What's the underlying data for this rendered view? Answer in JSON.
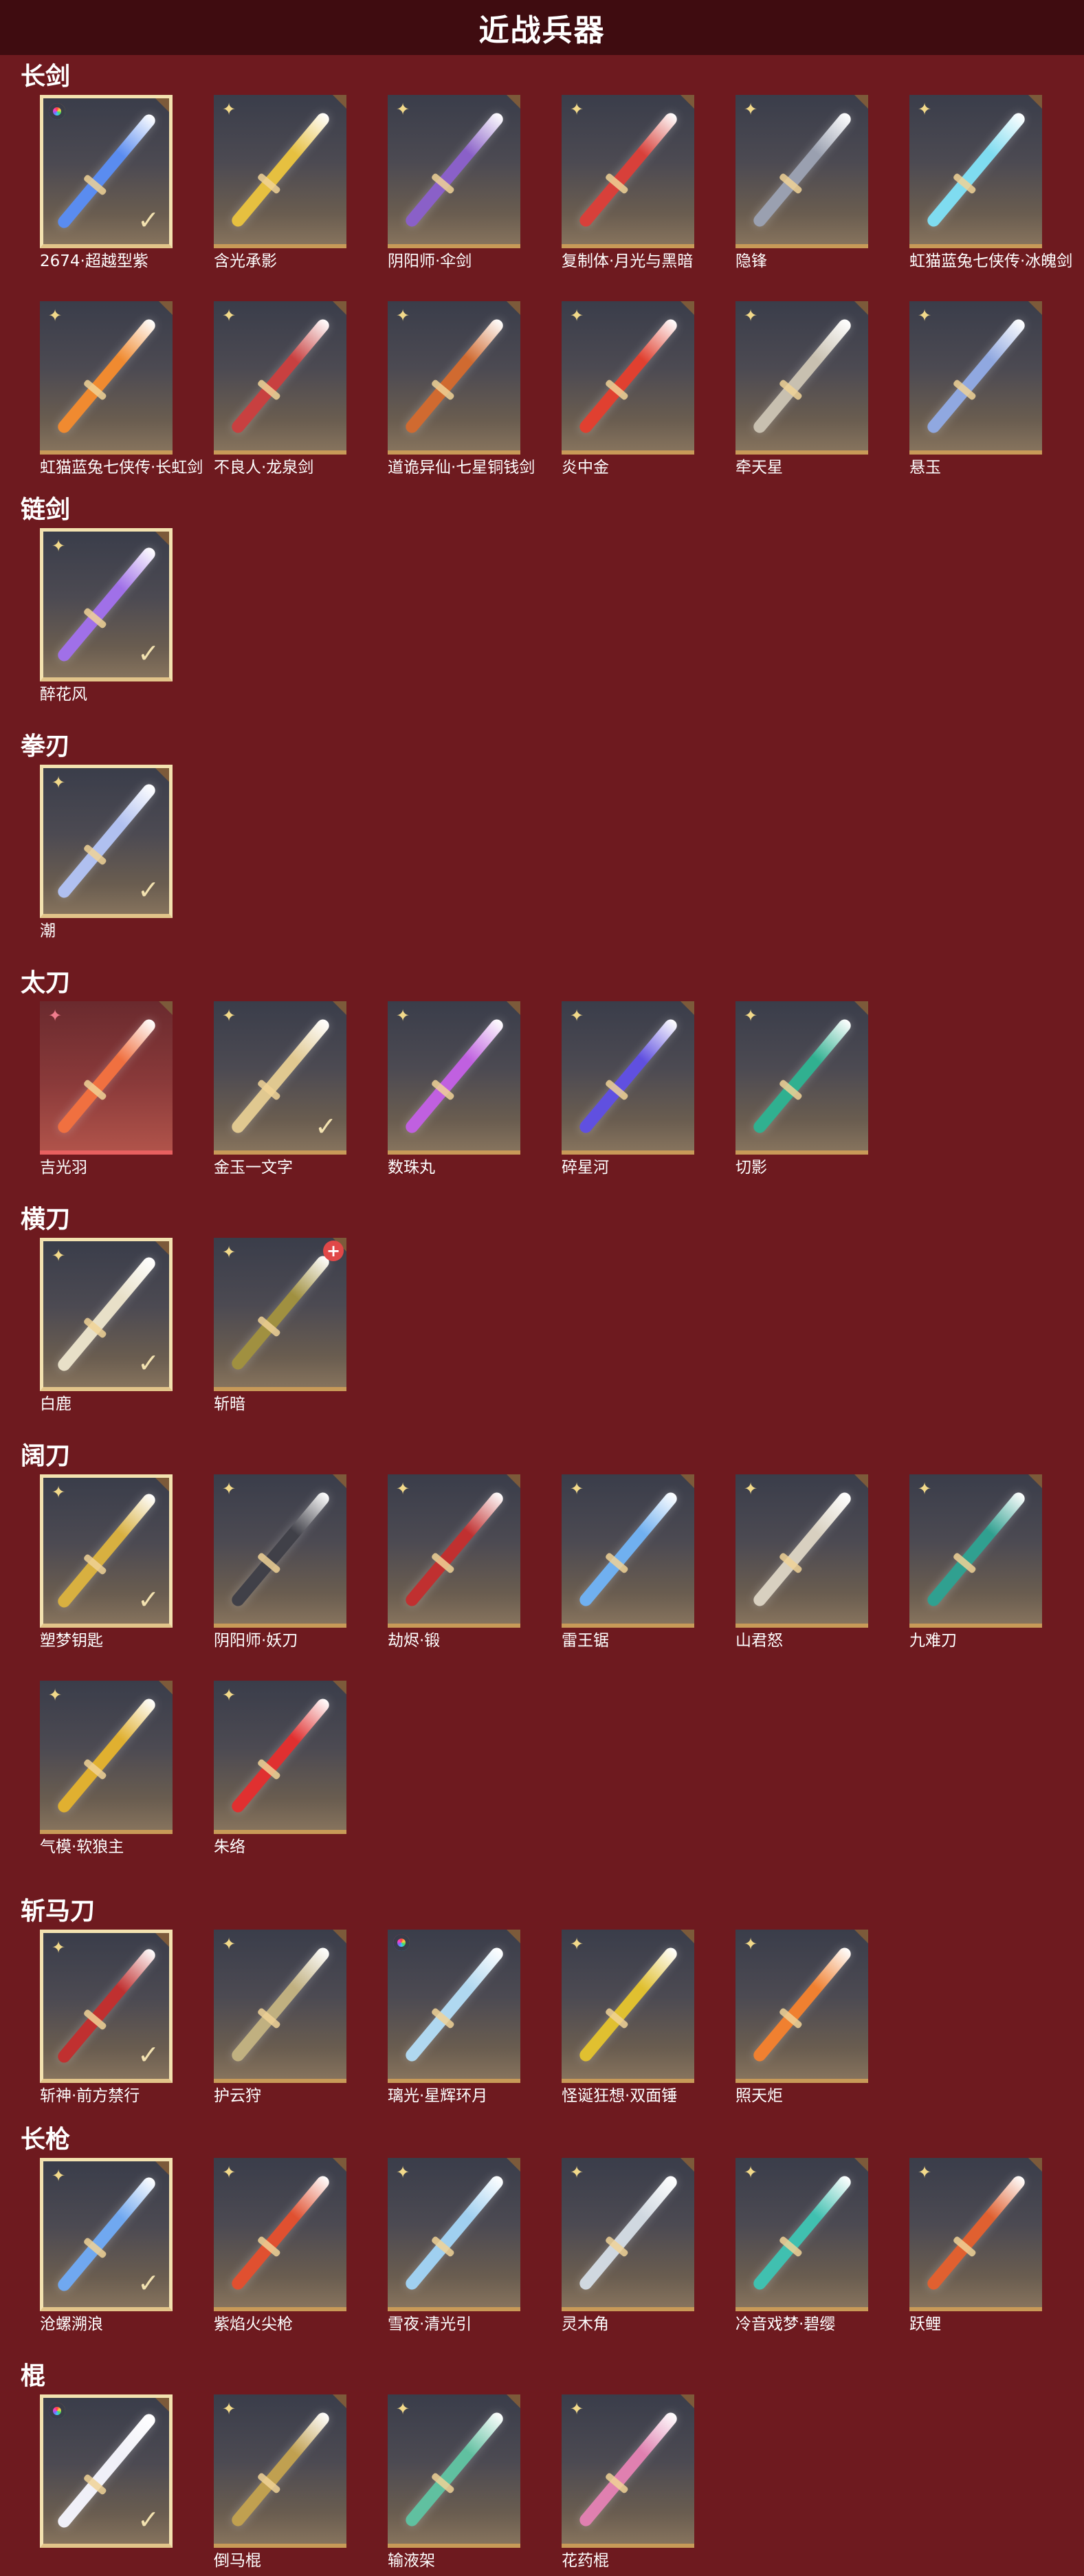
{
  "header": {
    "title": "近战兵器"
  },
  "sections": [
    {
      "title": "长剑",
      "items": [
        {
          "name": "2674·超越型紫",
          "badge": "rainbow",
          "selected": true,
          "color": "#5a8cf0"
        },
        {
          "name": "含光承影",
          "badge": "flower",
          "selected": false,
          "color": "#e6c040"
        },
        {
          "name": "阴阳师·伞剑",
          "badge": "flower",
          "selected": false,
          "color": "#8a60c8"
        },
        {
          "name": "复制体·月光与黑暗",
          "badge": "flower",
          "selected": false,
          "color": "#d8403a"
        },
        {
          "name": "隐锋",
          "badge": "flower",
          "selected": false,
          "color": "#9aa0b0"
        },
        {
          "name": "虹猫蓝兔七侠传·冰魄剑",
          "badge": "flower",
          "selected": false,
          "color": "#7fdcf0"
        },
        {
          "name": "虹猫蓝兔七侠传·长虹剑",
          "badge": "flower",
          "selected": false,
          "color": "#f08a30"
        },
        {
          "name": "不良人·龙泉剑",
          "badge": "flower",
          "selected": false,
          "color": "#c84040"
        },
        {
          "name": "道诡异仙·七星铜钱剑",
          "badge": "flower",
          "selected": false,
          "color": "#d06a30"
        },
        {
          "name": "炎中金",
          "badge": "flower",
          "selected": false,
          "color": "#e04030"
        },
        {
          "name": "牵天星",
          "badge": "flower",
          "selected": false,
          "color": "#c8c0b0"
        },
        {
          "name": "悬玉",
          "badge": "flower",
          "selected": false,
          "color": "#90a8e0"
        }
      ]
    },
    {
      "title": "链剑",
      "items": [
        {
          "name": "醉花风",
          "badge": "flower",
          "selected": true,
          "color": "#a070e8"
        }
      ]
    },
    {
      "title": "拳刃",
      "items": [
        {
          "name": "潮",
          "badge": "flower",
          "selected": true,
          "color": "#b0c0f0"
        }
      ]
    },
    {
      "title": "太刀",
      "items": [
        {
          "name": "吉光羽",
          "badge": "pink",
          "selected": false,
          "red": true,
          "color": "#f07040"
        },
        {
          "name": "金玉一文字",
          "badge": "flower",
          "selected": false,
          "check": true,
          "color": "#e0c890"
        },
        {
          "name": "数珠丸",
          "badge": "flower",
          "selected": false,
          "color": "#c060e0"
        },
        {
          "name": "碎星河",
          "badge": "flower",
          "selected": false,
          "color": "#6050e0"
        },
        {
          "name": "切影",
          "badge": "flower",
          "selected": false,
          "color": "#30b090"
        }
      ]
    },
    {
      "title": "横刀",
      "items": [
        {
          "name": "白鹿",
          "badge": "flower",
          "selected": true,
          "color": "#e8e0c8"
        },
        {
          "name": "斩暗",
          "badge": "flower",
          "selected": false,
          "plus": true,
          "color": "#a09040"
        }
      ]
    },
    {
      "title": "阔刀",
      "items": [
        {
          "name": "塑梦钥匙",
          "badge": "flower",
          "selected": true,
          "color": "#d8b040"
        },
        {
          "name": "阴阳师·妖刀",
          "badge": "flower",
          "selected": false,
          "color": "#404048"
        },
        {
          "name": "劫烬·锻",
          "badge": "flower",
          "selected": false,
          "color": "#c03030"
        },
        {
          "name": "雷王锯",
          "badge": "flower",
          "selected": false,
          "color": "#70b0f0"
        },
        {
          "name": "山君怒",
          "badge": "flower",
          "selected": false,
          "color": "#d8d0c0"
        },
        {
          "name": "九难刀",
          "badge": "flower",
          "selected": false,
          "color": "#30a090"
        },
        {
          "name": "气模·软狼主",
          "badge": "flower",
          "selected": false,
          "color": "#e0b030"
        },
        {
          "name": "朱络",
          "badge": "flower",
          "selected": false,
          "color": "#e03030"
        }
      ]
    },
    {
      "title": "斩马刀",
      "items": [
        {
          "name": "斩神·前方禁行",
          "badge": "flower",
          "selected": true,
          "color": "#c03030"
        },
        {
          "name": "护云狩",
          "badge": "flower",
          "selected": false,
          "color": "#c0b080"
        },
        {
          "name": "璃光·星辉环月",
          "badge": "rainbow",
          "selected": false,
          "color": "#b0d8f0"
        },
        {
          "name": "怪诞狂想·双面锤",
          "badge": "flower",
          "selected": false,
          "color": "#e0c030"
        },
        {
          "name": "照天炬",
          "badge": "flower",
          "selected": false,
          "color": "#f08030"
        }
      ]
    },
    {
      "title": "长枪",
      "items": [
        {
          "name": "沧螺溯浪",
          "badge": "flower",
          "selected": true,
          "color": "#70a8f0"
        },
        {
          "name": "紫焰火尖枪",
          "badge": "flower",
          "selected": false,
          "color": "#e05030"
        },
        {
          "name": "雪夜·清光引",
          "badge": "flower",
          "selected": false,
          "color": "#a0d0f0"
        },
        {
          "name": "灵木角",
          "badge": "flower",
          "selected": false,
          "color": "#d0d8e0"
        },
        {
          "name": "冷音戏梦·碧缨",
          "badge": "flower",
          "selected": false,
          "color": "#40c0b0"
        },
        {
          "name": "跃鲤",
          "badge": "flower",
          "selected": false,
          "color": "#e06030"
        }
      ]
    },
    {
      "title": "棍",
      "items": [
        {
          "name": "",
          "badge": "rainbow",
          "selected": true,
          "color": "#f0f0f8"
        },
        {
          "name": "倒马棍",
          "badge": "flower",
          "selected": false,
          "color": "#c0a050"
        },
        {
          "name": "输液架",
          "badge": "flower",
          "selected": false,
          "color": "#60c0a0"
        },
        {
          "name": "花药棍",
          "badge": "flower",
          "selected": false,
          "color": "#e080b0"
        }
      ]
    }
  ],
  "icons": {
    "flower": "flower-icon",
    "rainbow": "rainbow-ring-icon",
    "check": "checkmark-icon",
    "plus": "plus-badge-icon",
    "fold": "corner-fold-icon"
  }
}
